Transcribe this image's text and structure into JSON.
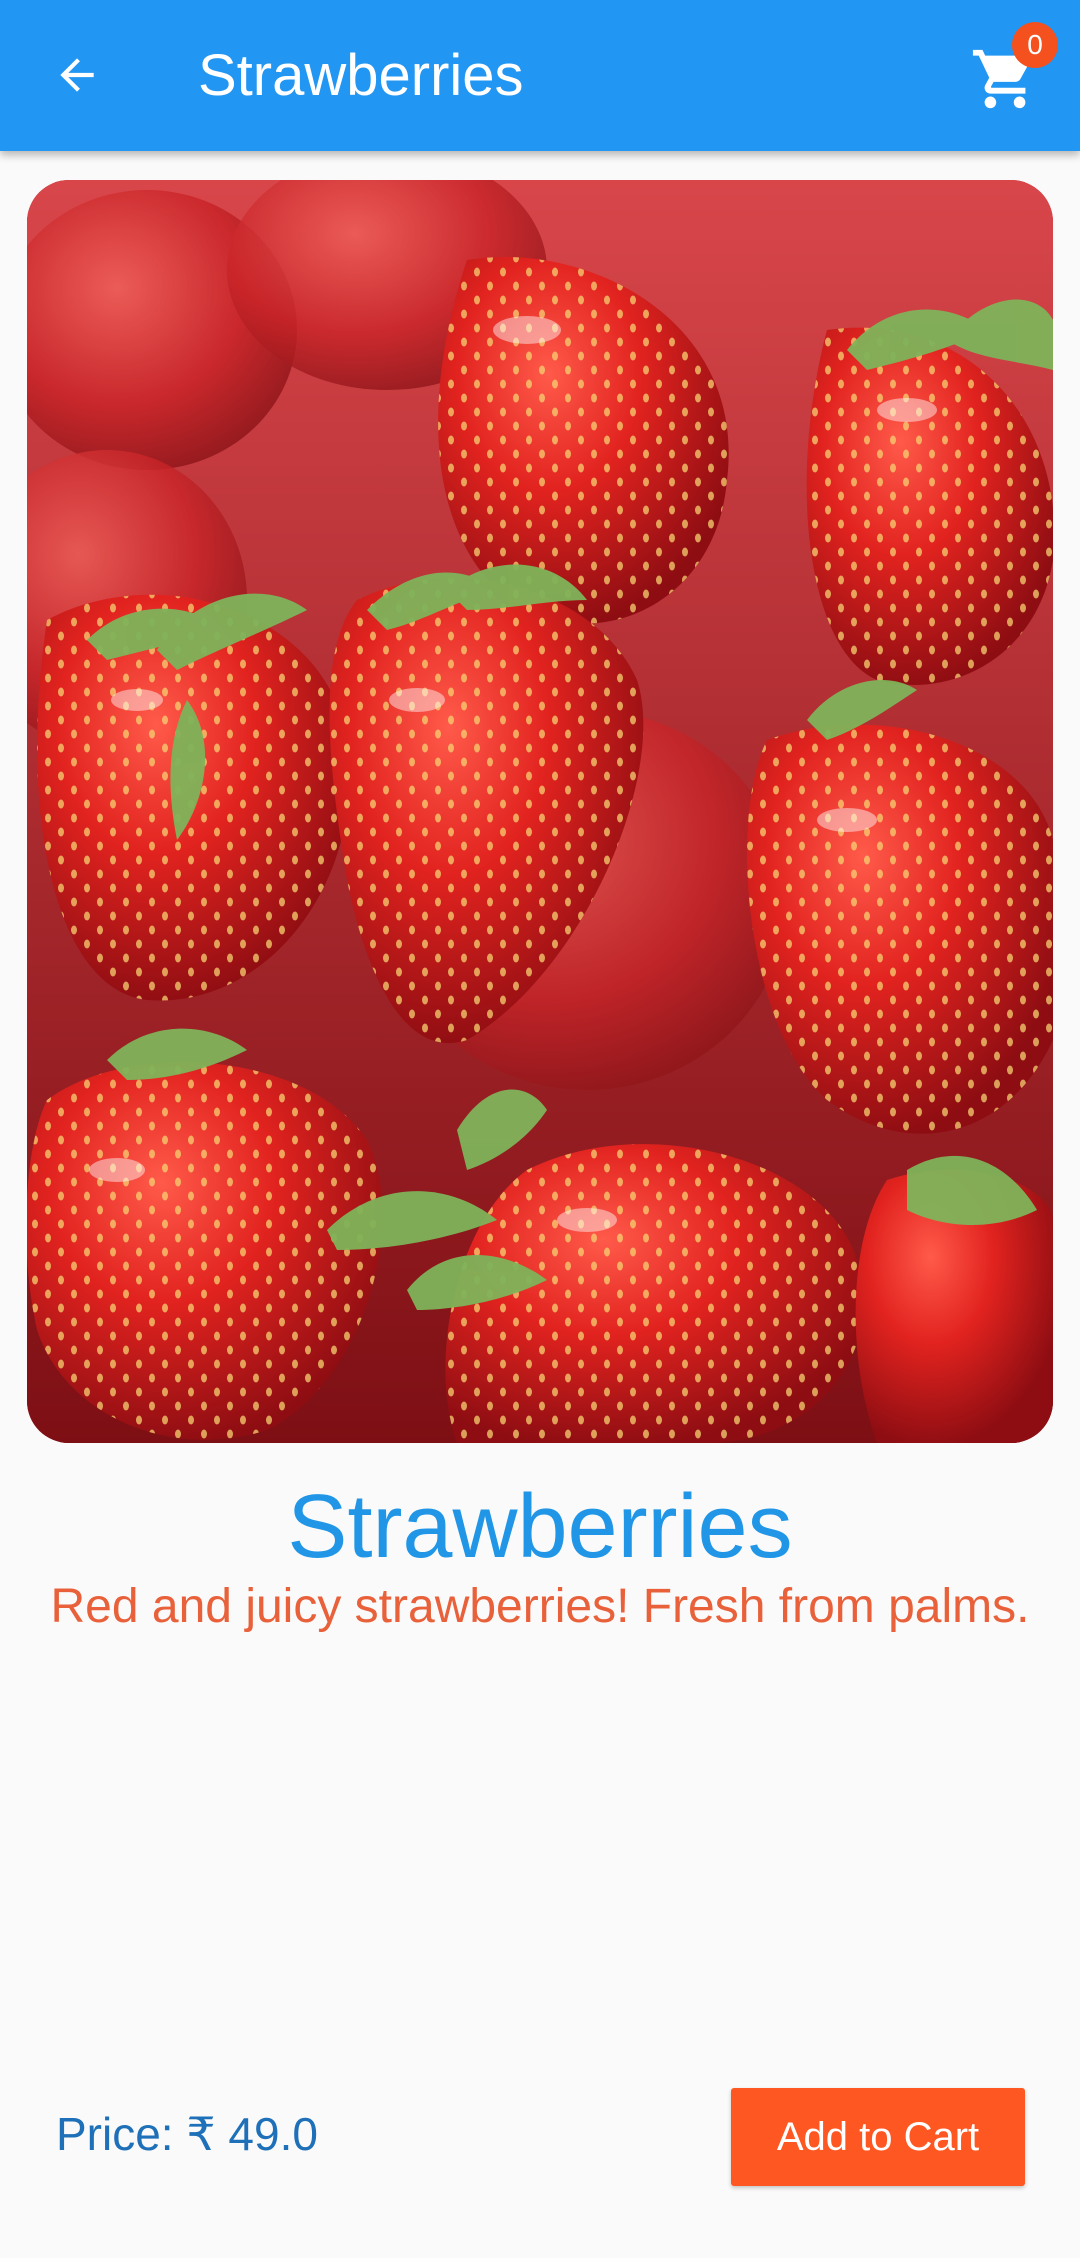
{
  "app_bar": {
    "title": "Strawberries",
    "back_icon": "arrow-left-icon",
    "cart_icon": "shopping-cart-icon",
    "cart_count": "0",
    "background_color": "#2196f3",
    "badge_color": "#f4511e"
  },
  "product": {
    "image": "strawberries-photo",
    "name": "Strawberries",
    "description": "Red and juicy strawberries! Fresh from palms.",
    "price_label": "Price: ₹ 49.0"
  },
  "actions": {
    "add_to_cart_label": "Add to Cart",
    "button_color": "#ff5722"
  }
}
